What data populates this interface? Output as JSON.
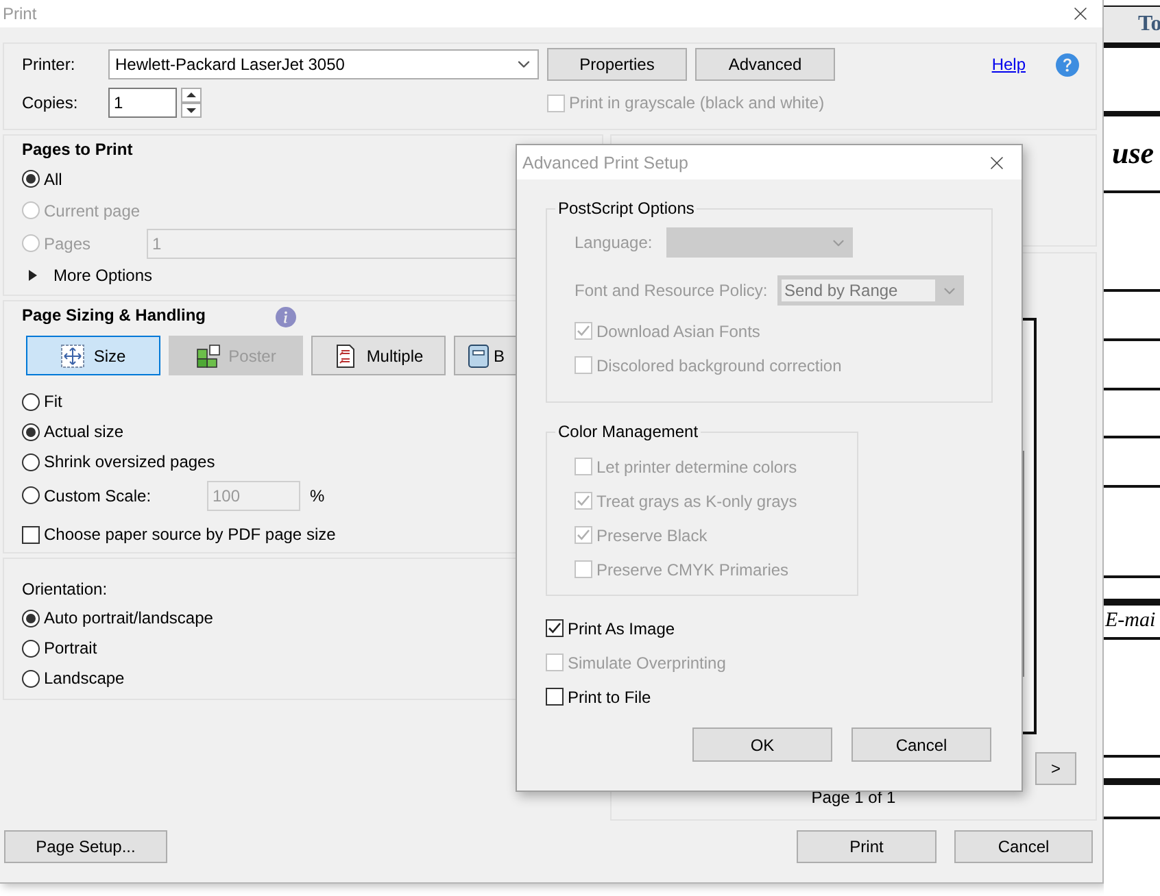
{
  "window": {
    "title": "Print"
  },
  "printer": {
    "label": "Printer:",
    "value": "Hewlett-Packard LaserJet 3050",
    "buttons": [
      "Properties",
      "Advanced"
    ]
  },
  "copies": {
    "label": "Copies:",
    "value": "1"
  },
  "help": {
    "label": "Help"
  },
  "grayscale": {
    "label": "Print in grayscale (black and white)",
    "checked": false,
    "disabled": true
  },
  "pages_to_print": {
    "title": "Pages to Print",
    "pages_value": "1",
    "more_options": "More Options",
    "options": [
      {
        "label": "All",
        "selected": true,
        "disabled": false
      },
      {
        "label": "Current page",
        "selected": false,
        "disabled": true
      },
      {
        "label": "Pages",
        "selected": false,
        "disabled": true
      }
    ]
  },
  "page_sizing": {
    "title": "Page Sizing & Handling",
    "modes": [
      {
        "kind": "size",
        "label": "Size",
        "selected": true,
        "disabled": false
      },
      {
        "kind": "poster",
        "label": "Poster",
        "selected": false,
        "disabled": true
      },
      {
        "kind": "multiple",
        "label": "Multiple",
        "selected": false,
        "disabled": false
      },
      {
        "kind": "booklet",
        "label": "B",
        "selected": false,
        "disabled": false
      }
    ],
    "options": [
      {
        "label": "Fit",
        "selected": false
      },
      {
        "label": "Actual size",
        "selected": true
      },
      {
        "label": "Shrink oversized pages",
        "selected": false
      },
      {
        "label": "Custom Scale:",
        "selected": false
      }
    ],
    "scale_value": "100",
    "scale_unit": "%",
    "paper_source": {
      "label": "Choose paper source by PDF page size",
      "checked": false
    }
  },
  "orientation": {
    "title": "Orientation:",
    "options": [
      {
        "label": "Auto portrait/landscape",
        "selected": true
      },
      {
        "label": "Portrait",
        "selected": false
      },
      {
        "label": "Landscape",
        "selected": false
      }
    ]
  },
  "preview": {
    "next": ">",
    "page_info": "Page 1 of 1"
  },
  "footer": {
    "page_setup": "Page Setup...",
    "print": "Print",
    "cancel": "Cancel"
  },
  "advanced_dialog": {
    "title": "Advanced Print Setup",
    "postscript": {
      "title": "PostScript Options",
      "language_label": "Language:",
      "policy_label": "Font and Resource Policy:",
      "policy_value": "Send by Range",
      "checkboxes": [
        {
          "label": "Download Asian Fonts",
          "checked": true,
          "disabled": true
        },
        {
          "label": "Discolored background correction",
          "checked": false,
          "disabled": true
        }
      ]
    },
    "color_management": {
      "title": "Color Management",
      "checkboxes": [
        {
          "label": "Let printer determine colors",
          "checked": false,
          "disabled": true
        },
        {
          "label": "Treat grays as K-only grays",
          "checked": true,
          "disabled": true
        },
        {
          "label": "Preserve Black",
          "checked": true,
          "disabled": true
        },
        {
          "label": "Preserve CMYK Primaries",
          "checked": false,
          "disabled": true
        }
      ]
    },
    "checkboxes": [
      {
        "label": "Print As Image",
        "checked": true,
        "disabled": false
      },
      {
        "label": "Simulate Overprinting",
        "checked": false,
        "disabled": true
      },
      {
        "label": "Print to File",
        "checked": false,
        "disabled": false
      }
    ],
    "buttons": [
      "OK",
      "Cancel"
    ]
  },
  "background_document": {
    "header": "To",
    "texts": [
      "use",
      "E-mai"
    ]
  }
}
